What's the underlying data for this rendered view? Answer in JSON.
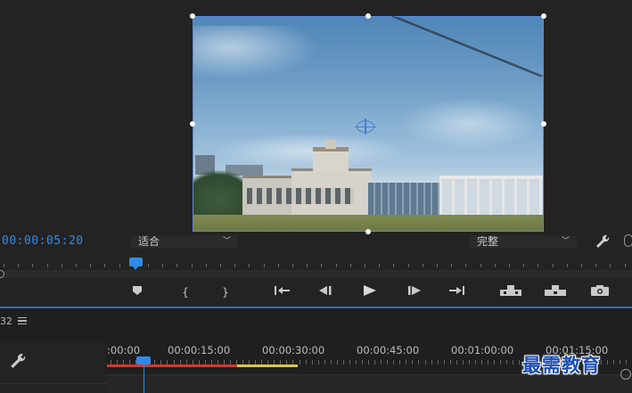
{
  "monitor": {
    "timecode": "00:00:05:20",
    "fit_select": "适合",
    "quality_select": "完整"
  },
  "transport": {
    "add_marker": "marker-icon",
    "mark_in": "{",
    "mark_out": "}",
    "go_to_in": "go-to-in-icon",
    "step_back": "step-back-icon",
    "play": "play-icon",
    "step_forward": "step-forward-icon",
    "go_to_out": "go-to-out-icon",
    "lift": "lift-icon",
    "extract": "extract-icon",
    "export_frame": "camera-icon"
  },
  "timeline": {
    "sequence_label": "32",
    "ruler_labels": [
      ":00:00",
      "00:00:15:00",
      "00:00:30:00",
      "00:00:45:00",
      "00:01:00:00",
      "00:01:15:00"
    ]
  },
  "watermark": "最需教育",
  "colors": {
    "accent": "#2d8ceb",
    "selection_border": "#5a8ad8",
    "render_red": "#d23a2e",
    "render_yellow": "#d7c94a"
  }
}
